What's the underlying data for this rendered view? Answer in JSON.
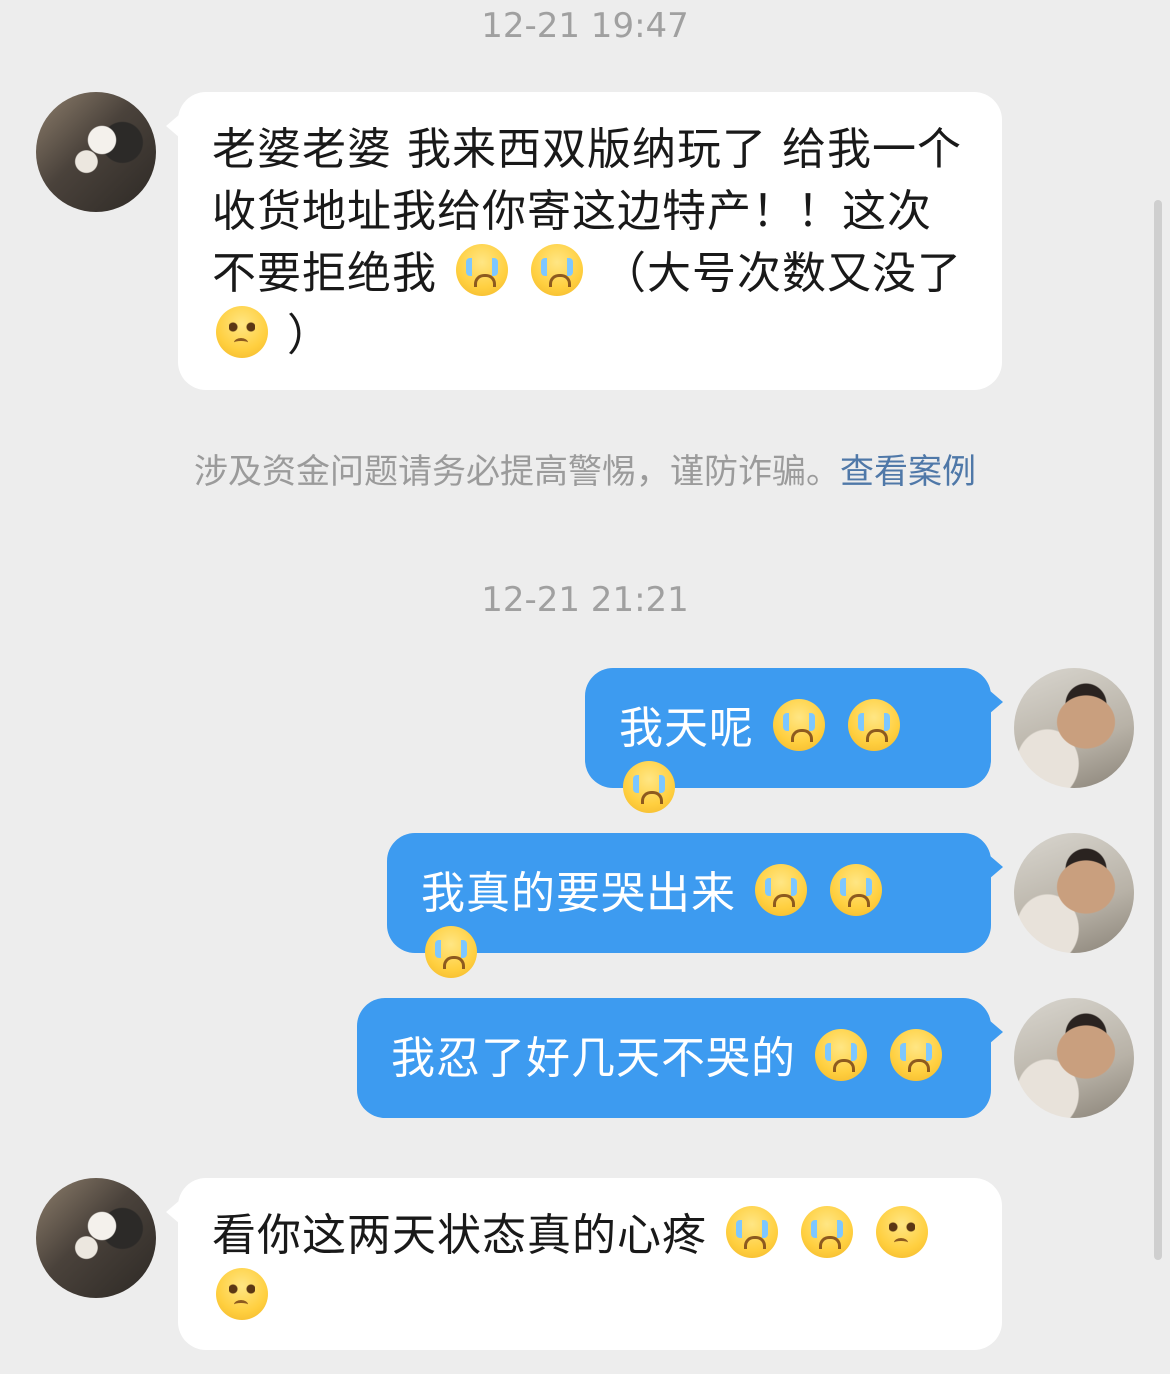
{
  "chat": {
    "timestamps": [
      "12-21 19:47",
      "12-21 21:21"
    ],
    "messages": {
      "first": "老婆老婆 我来西双版纳玩了 给我一个收货地址我给你寄这边特产！！这次不要拒绝我",
      "first_tail": "（大号次数又没了",
      "first_close": "）",
      "out_1": "我天呢",
      "out_2": "我真的要哭出来",
      "out_3": "我忍了好几天不哭的",
      "last": "看你这两天状态真的心疼"
    },
    "warning": {
      "text": "涉及资金问题请务必提高警惕，谨防诈骗。",
      "link": "查看案例"
    }
  },
  "icons": {
    "cry": "crying-face-emoji",
    "sad": "pleading-face-emoji"
  },
  "colors": {
    "background": "#ededed",
    "incoming_bubble": "#ffffff",
    "outgoing_bubble": "#3d9bf0",
    "timestamp": "#a0a0a0",
    "warning_link": "#4f78a8"
  }
}
